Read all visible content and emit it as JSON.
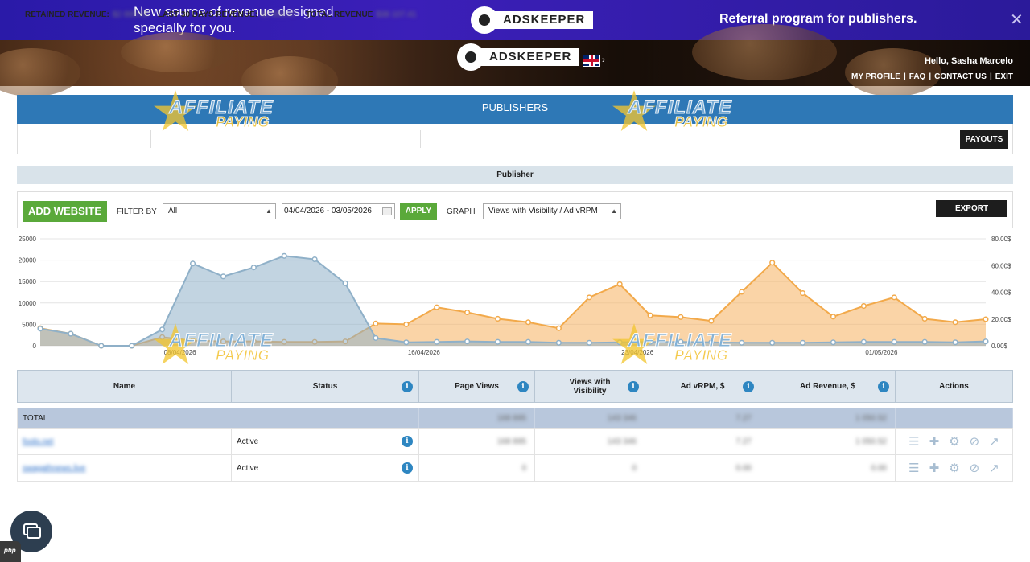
{
  "promo": {
    "line1_bold": "New source of revenue",
    "line1_light": " designed",
    "line2": "specially for you.",
    "brand": "ADSKEEPER",
    "referral": "Referral program for publishers.",
    "close": "✕"
  },
  "header": {
    "brand": "ADSKEEPER",
    "greeting": "Hello, Sasha Marcelo",
    "links": [
      "MY PROFILE",
      "FAQ",
      "CONTACT US",
      "EXIT"
    ]
  },
  "publishers": {
    "title": "PUBLISHERS",
    "retained_label": "RETAINED REVENUE:",
    "retained_value": "$2 895.65",
    "last30_label": "LAST 30 DAYS REVENUE:",
    "last30_value": "$1 805.07",
    "total_label": "TOTAL REVENUE",
    "total_value": "$38 107.41",
    "payouts": "PAYOUTS"
  },
  "section": {
    "title": "Publisher"
  },
  "toolbar": {
    "add_website": "ADD WEBSITE",
    "filter_label": "FILTER BY",
    "filter_value": "All",
    "date_range": "04/04/2026 - 03/05/2026",
    "apply": "APPLY",
    "graph_label": "GRAPH",
    "graph_value": "Views with Visibility / Ad vRPM",
    "export": "EXPORT"
  },
  "watermark": {
    "line1": "AFFILIATE",
    "line2": "PAYING"
  },
  "colors": {
    "views": "#8fb0c8",
    "rpm": "#f2a94a",
    "accent": "#2e78b6",
    "green": "#5aa93a"
  },
  "chart_data": {
    "type": "area",
    "x_ticks": [
      "08/04/2026",
      "16/04/2026",
      "23/04/2026",
      "01/05/2026"
    ],
    "y_left_ticks": [
      "25000",
      "20000",
      "15000",
      "10000",
      "5000",
      "0"
    ],
    "y_right_ticks": [
      "80.00$",
      "60.00$",
      "40.00$",
      "20.00$",
      "0.00$"
    ],
    "ylim_left": [
      0,
      25000
    ],
    "ylim_right": [
      0,
      80
    ],
    "series": [
      {
        "axis": "left",
        "values": [
          4000,
          2800,
          0,
          0,
          3800,
          19200,
          16200,
          18300,
          21000,
          20200,
          14600,
          1800,
          800,
          900,
          1000,
          900,
          900,
          700,
          700,
          800,
          900,
          900,
          800,
          700,
          700,
          700,
          800,
          900,
          900,
          900,
          800,
          1000
        ]
      },
      {
        "axis": "left",
        "values": [
          4100,
          2800,
          0,
          0,
          2000,
          1200,
          1000,
          1000,
          900,
          900,
          1000,
          5200,
          5000,
          9000,
          7800,
          6300,
          5500,
          4100,
          11300,
          14400,
          7100,
          6700,
          5800,
          12600,
          19400,
          12300,
          6800,
          9300,
          11300,
          6300,
          5500,
          6200
        ]
      }
    ]
  },
  "table": {
    "headers": [
      "Name",
      "Status",
      "Page Views",
      "Views with Visibility",
      "Ad vRPM, $",
      "Ad Revenue, $",
      "Actions"
    ],
    "total": {
      "label": "TOTAL",
      "page_views": "168 895",
      "views_vis": "143 346",
      "vrpm": "7.27",
      "revenue": "1 050.52"
    },
    "rows": [
      {
        "name": "foolo.net",
        "status": "Active",
        "page_views": "168 895",
        "views_vis": "143 346",
        "vrpm": "7.27",
        "revenue": "1 050.52"
      },
      {
        "name": "swagathnews.live",
        "status": "Active",
        "page_views": "0",
        "views_vis": "0",
        "vrpm": "0.00",
        "revenue": "0.00"
      }
    ],
    "action_icons": [
      "list-icon",
      "plus-icon",
      "gear-icon",
      "block-icon",
      "stats-icon"
    ]
  }
}
